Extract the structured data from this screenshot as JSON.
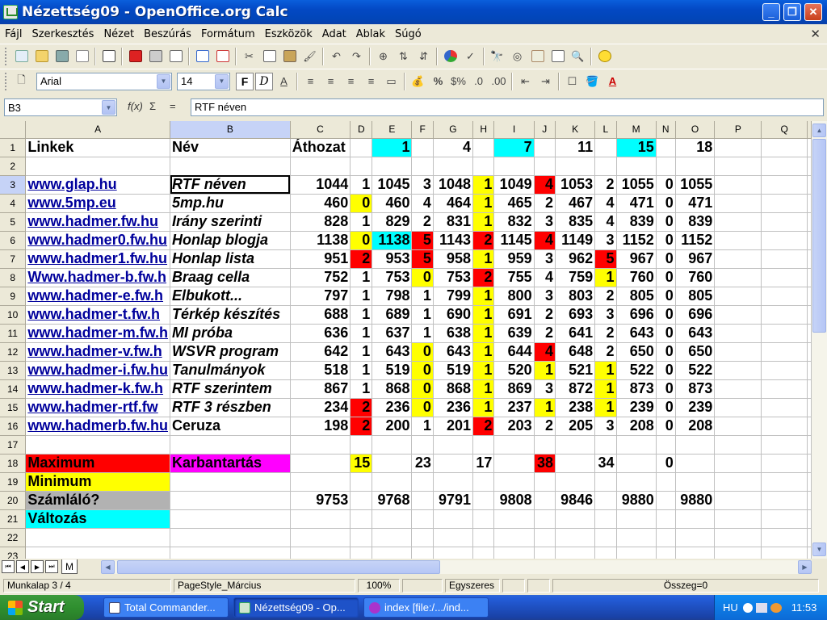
{
  "window": {
    "title": "Nézettség09 - OpenOffice.org Calc"
  },
  "menu": [
    "Fájl",
    "Szerkesztés",
    "Nézet",
    "Beszúrás",
    "Formátum",
    "Eszközök",
    "Adat",
    "Ablak",
    "Súgó"
  ],
  "toolbar2": {
    "font": "Arial",
    "size": "14"
  },
  "formula": {
    "cell_ref": "B3",
    "fx": "f(x)",
    "sum": "Σ",
    "eq": "=",
    "content": "RTF néven"
  },
  "columns": [
    "A",
    "B",
    "C",
    "D",
    "E",
    "F",
    "G",
    "H",
    "I",
    "J",
    "K",
    "L",
    "M",
    "N",
    "O",
    "P",
    "Q"
  ],
  "rows": [
    {
      "n": "1",
      "cells": [
        "Linkek",
        "Név",
        "Áthozat",
        "",
        "1",
        "",
        "4",
        "",
        "7",
        "",
        "11",
        "",
        "15",
        "",
        "18",
        "",
        ""
      ]
    },
    {
      "n": "2",
      "cells": [
        "",
        "",
        "",
        "",
        "",
        "",
        "",
        "",
        "",
        "",
        "",
        "",
        "",
        "",
        "",
        "",
        ""
      ]
    },
    {
      "n": "3",
      "cells": [
        "www.glap.hu",
        "RTF néven",
        "1044",
        "1",
        "1045",
        "3",
        "1048",
        "1",
        "1049",
        "4",
        "1053",
        "2",
        "1055",
        "0",
        "1055",
        "",
        ""
      ]
    },
    {
      "n": "4",
      "cells": [
        "www.5mp.eu",
        "5mp.hu",
        "460",
        "0",
        "460",
        "4",
        "464",
        "1",
        "465",
        "2",
        "467",
        "4",
        "471",
        "0",
        "471",
        "",
        ""
      ]
    },
    {
      "n": "5",
      "cells": [
        "www.hadmer.fw.hu",
        "Irány szerinti",
        "828",
        "1",
        "829",
        "2",
        "831",
        "1",
        "832",
        "3",
        "835",
        "4",
        "839",
        "0",
        "839",
        "",
        ""
      ]
    },
    {
      "n": "6",
      "cells": [
        "www.hadmer0.fw.hu",
        "Honlap blogja",
        "1138",
        "0",
        "1138",
        "5",
        "1143",
        "2",
        "1145",
        "4",
        "1149",
        "3",
        "1152",
        "0",
        "1152",
        "",
        ""
      ]
    },
    {
      "n": "7",
      "cells": [
        "www.hadmer1.fw.hu",
        "Honlap lista",
        "951",
        "2",
        "953",
        "5",
        "958",
        "1",
        "959",
        "3",
        "962",
        "5",
        "967",
        "0",
        "967",
        "",
        ""
      ]
    },
    {
      "n": "8",
      "cells": [
        "Www.hadmer-b.fw.h",
        "Braag cella",
        "752",
        "1",
        "753",
        "0",
        "753",
        "2",
        "755",
        "4",
        "759",
        "1",
        "760",
        "0",
        "760",
        "",
        ""
      ]
    },
    {
      "n": "9",
      "cells": [
        "www.hadmer-e.fw.h",
        "Elbukott...",
        "797",
        "1",
        "798",
        "1",
        "799",
        "1",
        "800",
        "3",
        "803",
        "2",
        "805",
        "0",
        "805",
        "",
        ""
      ]
    },
    {
      "n": "10",
      "cells": [
        "www.hadmer-t.fw.h",
        "Térkép készítés",
        "688",
        "1",
        "689",
        "1",
        "690",
        "1",
        "691",
        "2",
        "693",
        "3",
        "696",
        "0",
        "696",
        "",
        ""
      ]
    },
    {
      "n": "11",
      "cells": [
        "www.hadmer-m.fw.h",
        "MI próba",
        "636",
        "1",
        "637",
        "1",
        "638",
        "1",
        "639",
        "2",
        "641",
        "2",
        "643",
        "0",
        "643",
        "",
        ""
      ]
    },
    {
      "n": "12",
      "cells": [
        "www.hadmer-v.fw.h",
        "WSVR program",
        "642",
        "1",
        "643",
        "0",
        "643",
        "1",
        "644",
        "4",
        "648",
        "2",
        "650",
        "0",
        "650",
        "",
        ""
      ]
    },
    {
      "n": "13",
      "cells": [
        "www.hadmer-i.fw.hu",
        "Tanulmányok",
        "518",
        "1",
        "519",
        "0",
        "519",
        "1",
        "520",
        "1",
        "521",
        "1",
        "522",
        "0",
        "522",
        "",
        ""
      ]
    },
    {
      "n": "14",
      "cells": [
        "www.hadmer-k.fw.h",
        "RTF szerintem",
        "867",
        "1",
        "868",
        "0",
        "868",
        "1",
        "869",
        "3",
        "872",
        "1",
        "873",
        "0",
        "873",
        "",
        ""
      ]
    },
    {
      "n": "15",
      "cells": [
        "www.hadmer-rtf.fw",
        "RTF 3 részben",
        "234",
        "2",
        "236",
        "0",
        "236",
        "1",
        "237",
        "1",
        "238",
        "1",
        "239",
        "0",
        "239",
        "",
        ""
      ]
    },
    {
      "n": "16",
      "cells": [
        "www.hadmerb.fw.hu",
        "Ceruza",
        "198",
        "2",
        "200",
        "1",
        "201",
        "2",
        "203",
        "2",
        "205",
        "3",
        "208",
        "0",
        "208",
        "",
        ""
      ]
    },
    {
      "n": "17",
      "cells": [
        "",
        "",
        "",
        "",
        "",
        "",
        "",
        "",
        "",
        "",
        "",
        "",
        "",
        "",
        "",
        "",
        ""
      ]
    },
    {
      "n": "18",
      "cells": [
        "Maximum",
        "Karbantartás",
        "",
        "15",
        "",
        "23",
        "",
        "17",
        "",
        "38",
        "",
        "34",
        "",
        "0",
        "",
        "",
        ""
      ]
    },
    {
      "n": "19",
      "cells": [
        "Minimum",
        "",
        "",
        "",
        "",
        "",
        "",
        "",
        "",
        "",
        "",
        "",
        "",
        "",
        "",
        "",
        ""
      ]
    },
    {
      "n": "20",
      "cells": [
        "Számláló?",
        "",
        "9753",
        "",
        "9768",
        "",
        "9791",
        "",
        "9808",
        "",
        "9846",
        "",
        "9880",
        "",
        "9880",
        "",
        ""
      ]
    },
    {
      "n": "21",
      "cells": [
        "Változás",
        "",
        "",
        "",
        "",
        "",
        "",
        "",
        "",
        "",
        "",
        "",
        "",
        "",
        "",
        "",
        ""
      ]
    },
    {
      "n": "22",
      "cells": [
        "",
        "",
        "",
        "",
        "",
        "",
        "",
        "",
        "",
        "",
        "",
        "",
        "",
        "",
        "",
        "",
        ""
      ]
    },
    {
      "n": "23",
      "cells": [
        "",
        "",
        "",
        "",
        "",
        "",
        "",
        "",
        "",
        "",
        "",
        "",
        "",
        "",
        "",
        "",
        ""
      ]
    }
  ],
  "cell_colors": {
    "cyan": "#00ffff",
    "yellow": "#ffff00",
    "red": "#ff0000",
    "magenta": "#ff00ff",
    "gray": "#b2b2b2"
  },
  "sheet_tabs": {
    "active": "M"
  },
  "status": {
    "sheet": "Munkalap 3 / 4",
    "style": "PageStyle_Március",
    "zoom": "100%",
    "mode": "Egyszeres",
    "sum": "Összeg=0"
  },
  "taskbar": {
    "start": "Start",
    "tasks": [
      "Total Commander...",
      "Nézettség09 - Op...",
      "index [file:/.../ind..."
    ],
    "lang": "HU",
    "clock": "11:53"
  }
}
